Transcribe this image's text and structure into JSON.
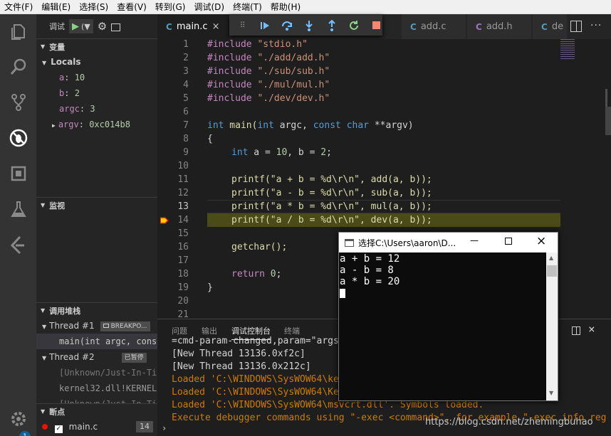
{
  "menu": [
    "文件(F)",
    "编辑(E)",
    "选择(S)",
    "查看(V)",
    "转到(G)",
    "调试(D)",
    "终端(T)",
    "帮助(H)"
  ],
  "debug_toolbar": {
    "label": "调试",
    "config": "(▼"
  },
  "sections": {
    "variables": "变量",
    "locals": "Locals",
    "watch": "监视",
    "callstack": "调用堆栈",
    "breakpoints": "断点"
  },
  "locals": [
    {
      "name": "a",
      "value": "10"
    },
    {
      "name": "b",
      "value": "2"
    },
    {
      "name": "argc",
      "value": "3"
    },
    {
      "name": "argv",
      "value": "0xc014b8"
    }
  ],
  "threads": [
    {
      "name": "Thread #1",
      "badge": "BREAKPO..."
    },
    {
      "name": "Thread #2",
      "badge": "已暂停"
    }
  ],
  "frames": {
    "t1": "main(int argc, const",
    "t2a": "[Unknown/Just-In-Ti",
    "t2b": "kernel32.dll!KERNEL",
    "t2c": "[Unknown/Just-In-Ti"
  },
  "breakpoint": {
    "file": "main.c",
    "line": "14"
  },
  "badge_count": "1",
  "tabs": [
    {
      "label": "main.c",
      "active": true,
      "type": "C"
    },
    {
      "label": "add.c",
      "active": false,
      "type": "C"
    },
    {
      "label": "add.h",
      "active": false,
      "type": "C"
    },
    {
      "label": "de",
      "active": false,
      "type": "C"
    }
  ],
  "code": {
    "lines": [
      "1",
      "2",
      "3",
      "4",
      "5",
      "6",
      "7",
      "8",
      "9",
      "10",
      "11",
      "12",
      "13",
      "14",
      "15",
      "16",
      "17",
      "18",
      "19",
      "20",
      "21"
    ],
    "inc1": "\"stdio.h\"",
    "inc2": "\"./add/add.h\"",
    "inc3": "\"./sub/sub.h\"",
    "inc4": "\"./mul/mul.h\"",
    "inc5": "\"./dev/dev.h\"",
    "include": "#include",
    "l7a": "int",
    "l7b": " main(",
    "l7c": "int",
    "l7d": " argc, ",
    "l7e": "const",
    "l7f": " ",
    "l7g": "char",
    "l7h": " **argv)",
    "l8": "{",
    "l9a": "int",
    "l9b": " a = ",
    "l9c": "10",
    "l9d": ", b = ",
    "l9e": "2",
    "l9f": ";",
    "l11": "printf(\"a + b = %d\\r\\n\", add(a, b));",
    "l12": "printf(\"a - b = %d\\r\\n\", sub(a, b));",
    "l13": "printf(\"a * b = %d\\r\\n\", mul(a, b));",
    "l14": "printf(\"a / b = %d\\r\\n\", dev(a, b));",
    "l16": "getchar();",
    "l18a": "return",
    "l18b": " ",
    "l18c": "0",
    "l18d": ";",
    "l19": "}"
  },
  "panel": {
    "tabs": [
      "问题",
      "输出",
      "调试控制台",
      "终端"
    ],
    "lines": [
      {
        "text": "=cmd-param-changed,param=\"args",
        "cls": "ok"
      },
      {
        "text": "[New Thread 13136.0xf2c]",
        "cls": "ok"
      },
      {
        "text": "[New Thread 13136.0x212c]",
        "cls": "ok"
      },
      {
        "text": "Loaded 'C:\\WINDOWS\\SysWOW64\\ker",
        "cls": "warn"
      },
      {
        "text": "Loaded 'C:\\WINDOWS\\SysWOW64\\Ker",
        "cls": "warn"
      },
      {
        "text": "Loaded 'C:\\WINDOWS\\SysWOW64\\msvcrt.dll'. Symbols loaded.",
        "cls": "warn"
      },
      {
        "text": "Execute debugger commands using \"-exec <command>\", for example \"-exec info reg",
        "cls": "warn"
      }
    ]
  },
  "console_window": {
    "title": "选择C:\\Users\\aaron\\D...",
    "lines": [
      "a + b = 12",
      "a - b = 8",
      "a * b = 20"
    ]
  },
  "watermark": "https://blog.csdn.net/zhemingbuhao"
}
